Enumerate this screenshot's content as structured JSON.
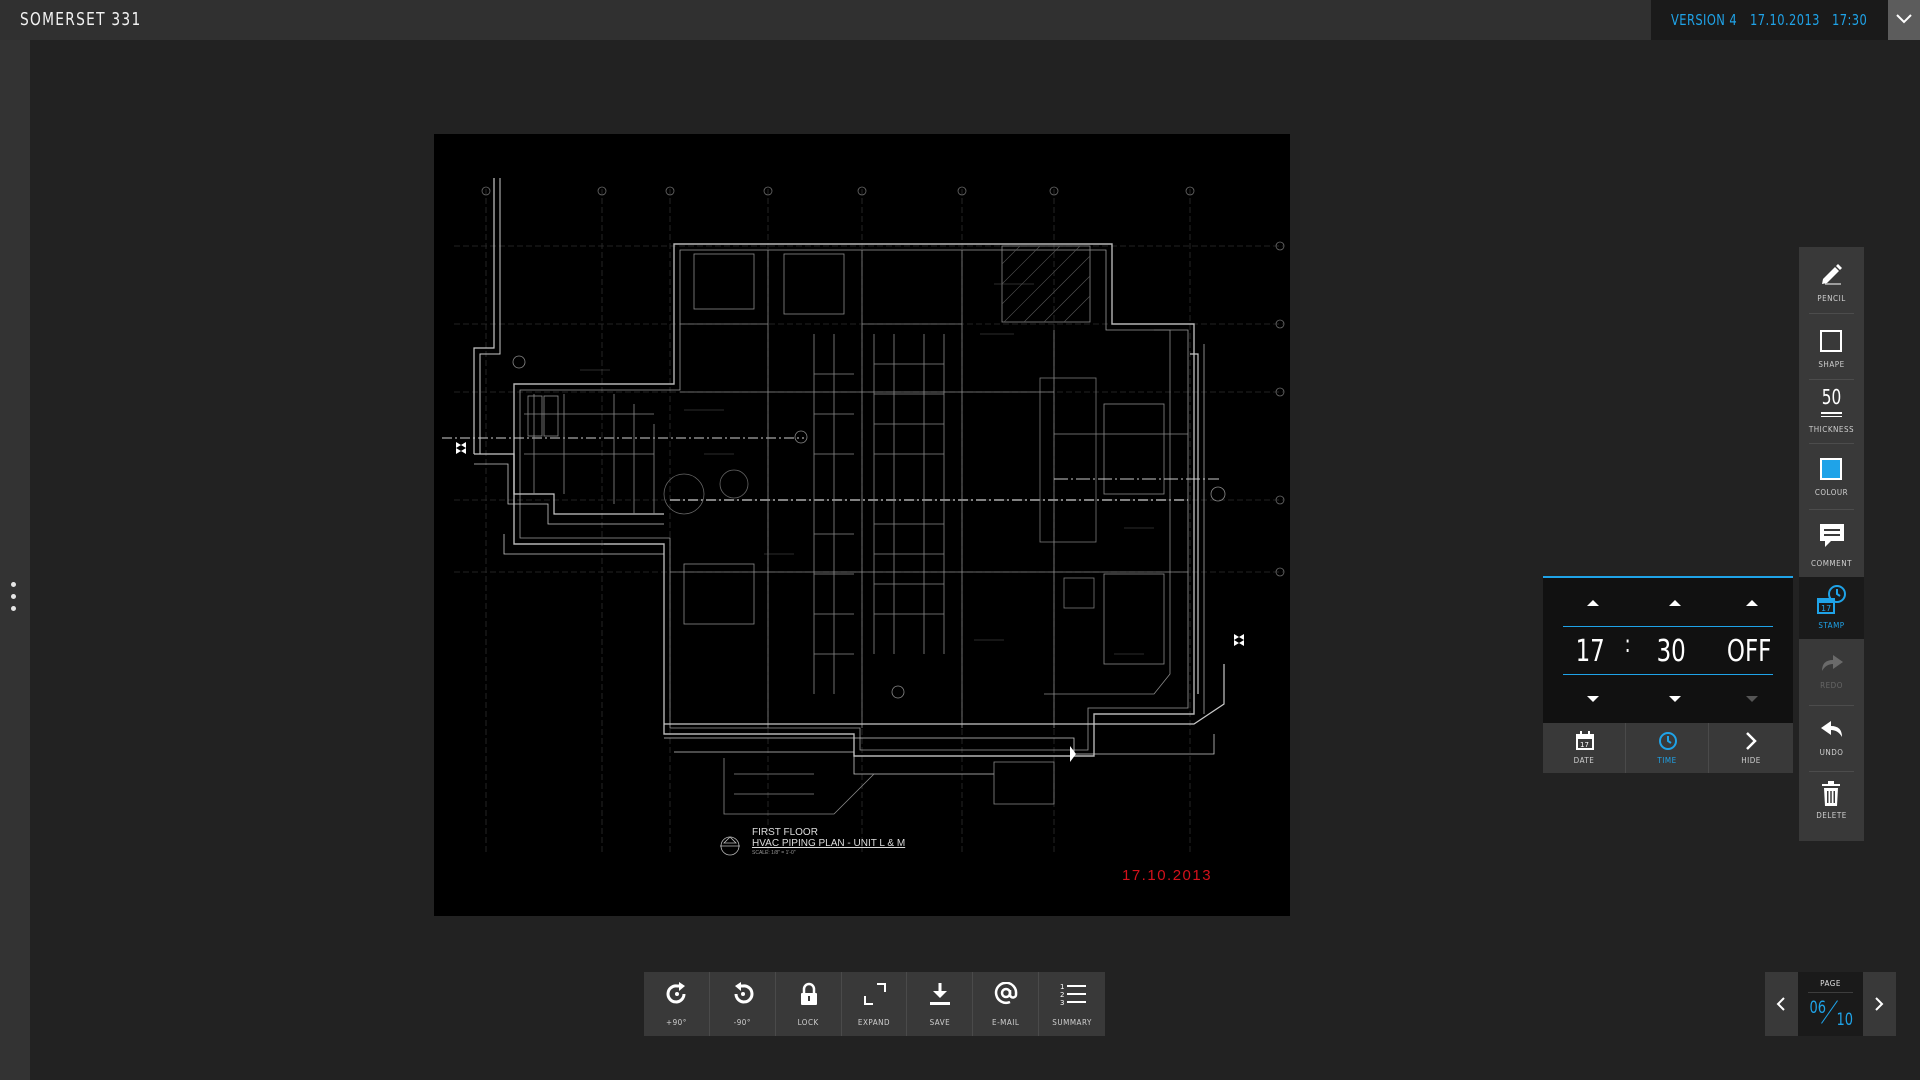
{
  "app": {
    "title": "SOMERSET 331",
    "version": "VERSION 4",
    "date": "17.10.2013",
    "time": "17:30"
  },
  "drawing": {
    "plan_title": "FIRST FLOOR",
    "plan_subtitle": "HVAC PIPING PLAN - UNIT L & M",
    "plan_scale": "SCALE: 1/8\" = 1'-0\"",
    "stamp_date": "17.10.2013"
  },
  "toolbar": {
    "items": [
      {
        "label": "+90°",
        "icon": "rotate-cw-icon"
      },
      {
        "label": "-90°",
        "icon": "rotate-ccw-icon"
      },
      {
        "label": "LOCK",
        "icon": "lock-icon"
      },
      {
        "label": "EXPAND",
        "icon": "expand-icon"
      },
      {
        "label": "SAVE",
        "icon": "download-icon"
      },
      {
        "label": "E-MAIL",
        "icon": "at-icon"
      },
      {
        "label": "SUMMARY",
        "icon": "numbered-list-icon"
      }
    ]
  },
  "tools": {
    "pencil": "PENCIL",
    "shape": "SHAPE",
    "thickness": "THICKNESS",
    "thickness_value": "50",
    "colour": "COLOUR",
    "colour_value": "#1fa3e8",
    "comment": "COMMENT",
    "stamp": "STAMP",
    "redo": "REDO",
    "undo": "UNDO",
    "delete": "DELETE"
  },
  "stamp_panel": {
    "hour": "17",
    "separator": ":",
    "minute": "30",
    "ampm": "OFF",
    "date_label": "DATE",
    "time_label": "TIME",
    "hide_label": "HIDE",
    "calendar_day": "17"
  },
  "pager": {
    "label": "PAGE",
    "current": "06",
    "total": "10"
  },
  "colors": {
    "accent": "#1fa3e8",
    "stamp_red": "#d4111b"
  }
}
